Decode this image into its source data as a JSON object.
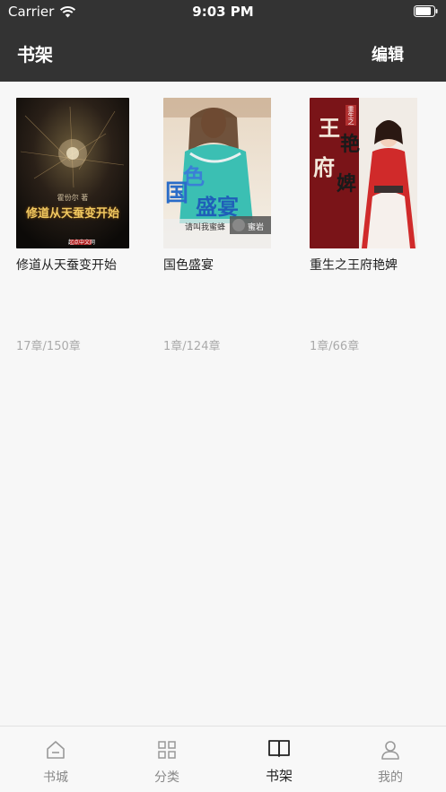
{
  "status": {
    "carrier": "Carrier",
    "time": "9:03 PM"
  },
  "nav": {
    "title": "书架",
    "edit_label": "编辑"
  },
  "books": [
    {
      "title": "修道从天蚕变开始",
      "progress": "17章/150章",
      "cover_text": "修道从天蚕变开始",
      "cover_author": "霍份尔 著",
      "cover_badge": "起点中文网"
    },
    {
      "title": "国色盛宴",
      "progress": "1章/124章",
      "cover_text_a": "色",
      "cover_text_b": "国",
      "cover_text_c": "盛宴",
      "cover_author": "请叫我蜜蜂",
      "cover_badge": "蜜岩"
    },
    {
      "title": "重生之王府艳婢",
      "progress": "1章/66章",
      "cover_text_a": "王",
      "cover_text_b": "府",
      "cover_text_c": "艳",
      "cover_text_d": "婢",
      "cover_text_e": "重生之"
    }
  ],
  "tabs": [
    {
      "label": "书城",
      "icon": "home-icon"
    },
    {
      "label": "分类",
      "icon": "grid-icon"
    },
    {
      "label": "书架",
      "icon": "book-icon"
    },
    {
      "label": "我的",
      "icon": "user-icon"
    }
  ],
  "colors": {
    "topbar": "#333333",
    "background": "#f7f7f7",
    "progress": "#aaaaaa"
  }
}
